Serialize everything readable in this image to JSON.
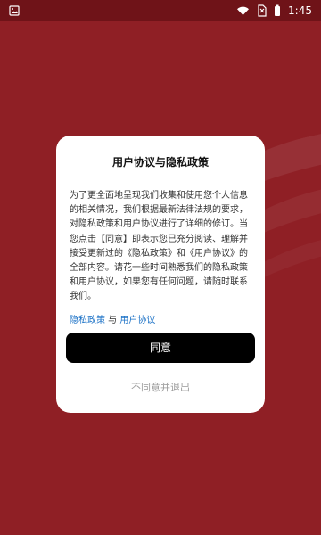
{
  "status_bar": {
    "time": "1:45",
    "icons": [
      "image-icon",
      "wifi-icon",
      "no-sim-icon",
      "battery-icon"
    ]
  },
  "dialog": {
    "title": "用户协议与隐私政策",
    "body": "为了更全面地呈现我们收集和使用您个人信息的相关情况，我们根据最新法律法规的要求，对隐私政策和用户协议进行了详细的修订。当您点击【同意】即表示您已充分阅读、理解并接受更新过的《隐私政策》和《用户协议》的全部内容。请花一些时间熟悉我们的隐私政策和用户协议，如果您有任何问题，请随时联系我们。",
    "privacy_link": "隐私政策",
    "link_separator": " 与 ",
    "user_agreement_link": "用户协议",
    "agree_button": "同意",
    "disagree_exit": "不同意并退出"
  },
  "colors": {
    "background": "#8f1f25",
    "status_bar": "#6f1318",
    "link": "#1e73c7",
    "button": "#000000",
    "dialog": "#ffffff"
  }
}
